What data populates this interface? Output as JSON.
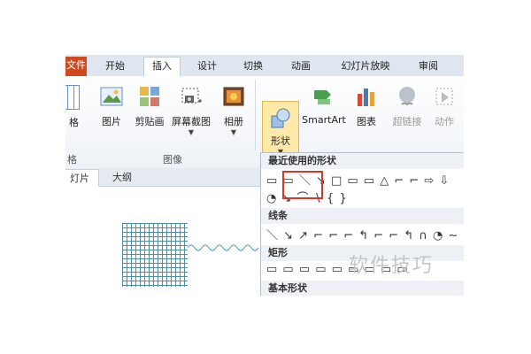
{
  "ribbon_tabs": {
    "file": "文件",
    "home": "开始",
    "insert": "插入",
    "design": "设计",
    "transitions": "切换",
    "animations": "动画",
    "slideshow": "幻灯片放映",
    "review": "审阅"
  },
  "ribbon": {
    "table_label_fragment": "格",
    "group_fragment": "格",
    "picture": "图片",
    "clipart": "剪贴画",
    "screenshot": "屏幕截图",
    "album": "相册",
    "images_group": "图像",
    "shapes": "形状",
    "smartart": "SmartArt",
    "chart": "图表",
    "hyperlink": "超链接",
    "action": "动作"
  },
  "left_pane": {
    "slides_tab": "灯片",
    "outline_tab": "大纲"
  },
  "shapes_menu": {
    "recent_header": "最近使用的形状",
    "lines_header": "线条",
    "rect_header": "矩形",
    "basic_header": "基本形状",
    "recent_row1": "▭ ▭ ＼ ↘ □ ▭ ▭ △ ⌐ ⌐ ⇨ ⇩",
    "recent_row2": "◔ ↘ ⌒ ∖ { }",
    "lines_row": "＼ ↘ ↗ ⌐ ⌐ ⌐ ↰ ⌐ ⌐ ↰ ∩ ◔ ~",
    "rect_row": "▭ ▭ ▭ ▭ ▭ ▭ ▭ ▭ ▭"
  },
  "watermark": "软件技巧",
  "icons": {
    "picture": "picture-icon",
    "clipart": "clipart-icon",
    "screenshot": "screenshot-icon",
    "album": "album-icon",
    "shapes": "shapes-icon",
    "smartart": "smartart-icon",
    "chart": "chart-icon",
    "hyperlink": "hyperlink-icon",
    "action": "action-icon"
  },
  "colors": {
    "file_tab": "#d04a1e",
    "highlight": "#d23a2e",
    "grid": "#4f8f9f",
    "shapes_button": "#fde9a8"
  }
}
